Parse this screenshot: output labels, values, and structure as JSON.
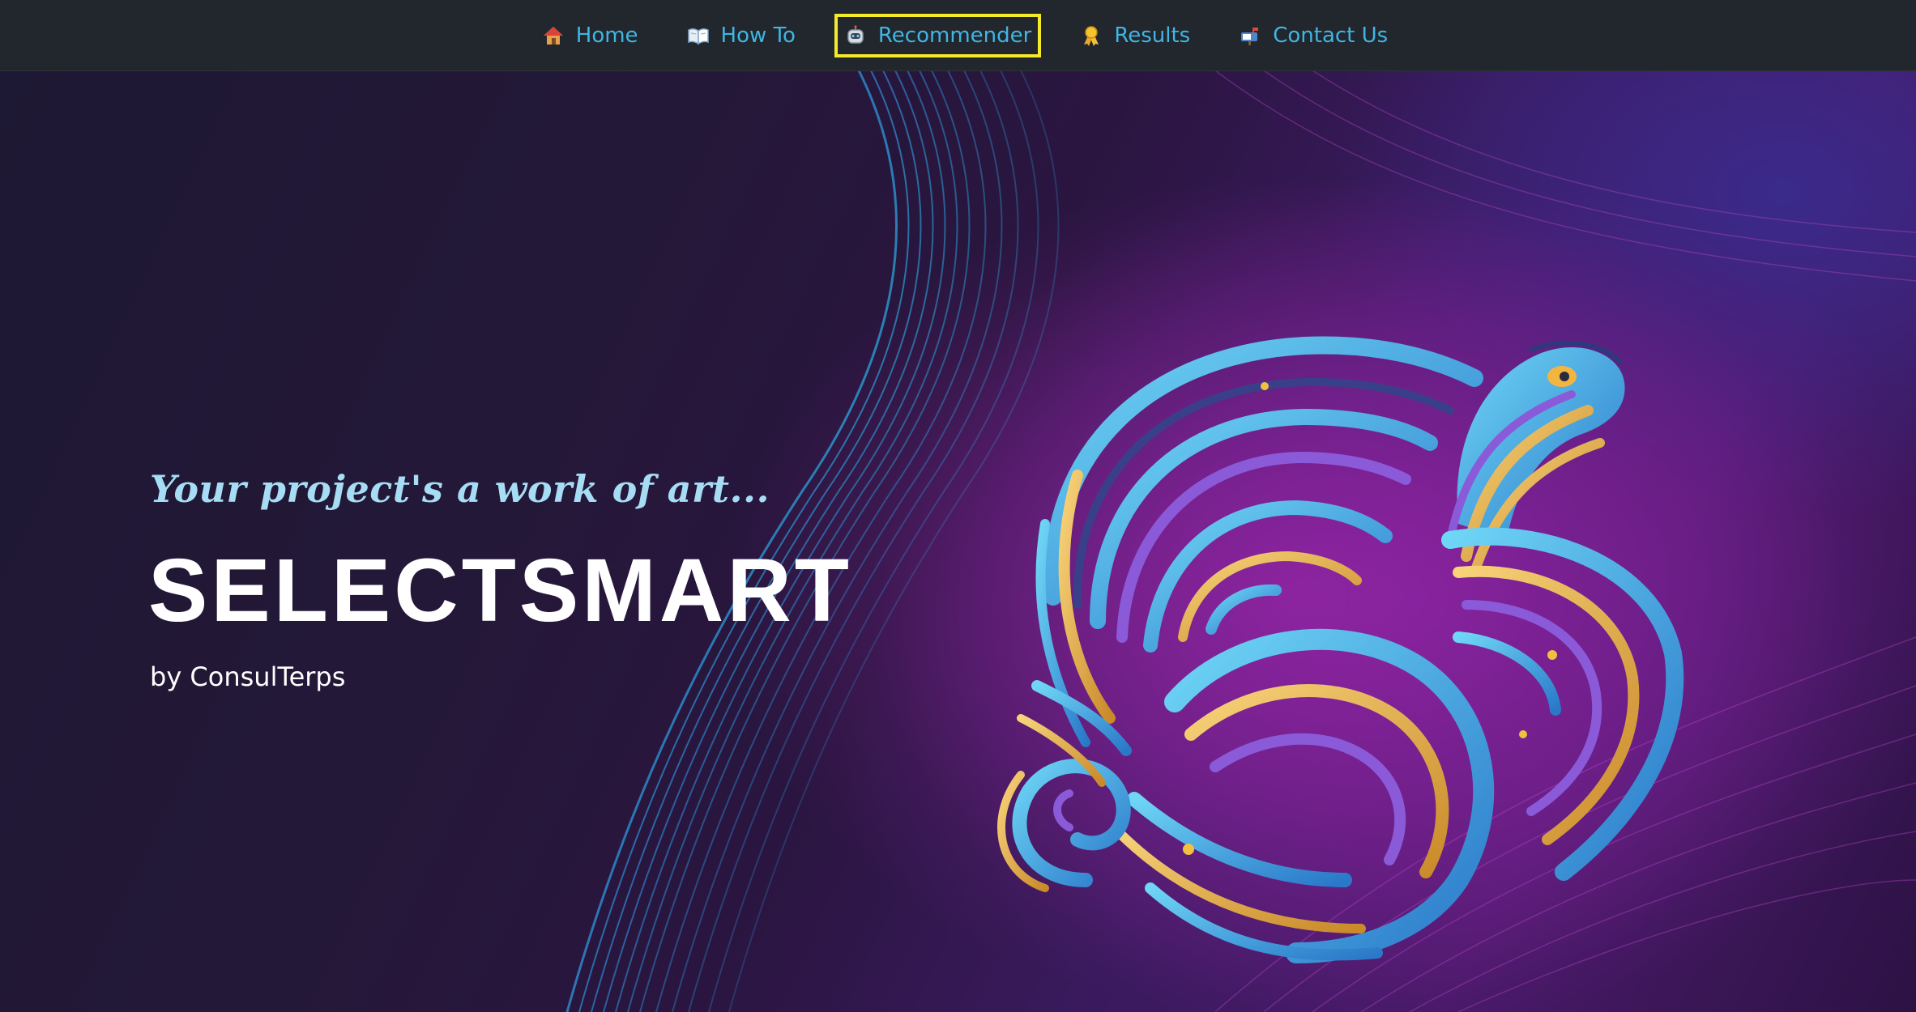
{
  "nav": {
    "items": [
      {
        "label": "Home",
        "icon": "house-icon"
      },
      {
        "label": "How To",
        "icon": "open-book-icon"
      },
      {
        "label": "Recommender",
        "icon": "robot-icon",
        "active": true
      },
      {
        "label": "Results",
        "icon": "ribbon-icon"
      },
      {
        "label": "Contact Us",
        "icon": "mailbox-icon"
      }
    ],
    "active_highlight_color": "#f2ea2a",
    "link_color": "#3fb6e3",
    "background": "#22262d"
  },
  "hero": {
    "tagline": "Your project's a work of art...",
    "title": "SELECTSMART",
    "byline": "by ConsulTerps",
    "artwork": "turtle-illustration"
  }
}
